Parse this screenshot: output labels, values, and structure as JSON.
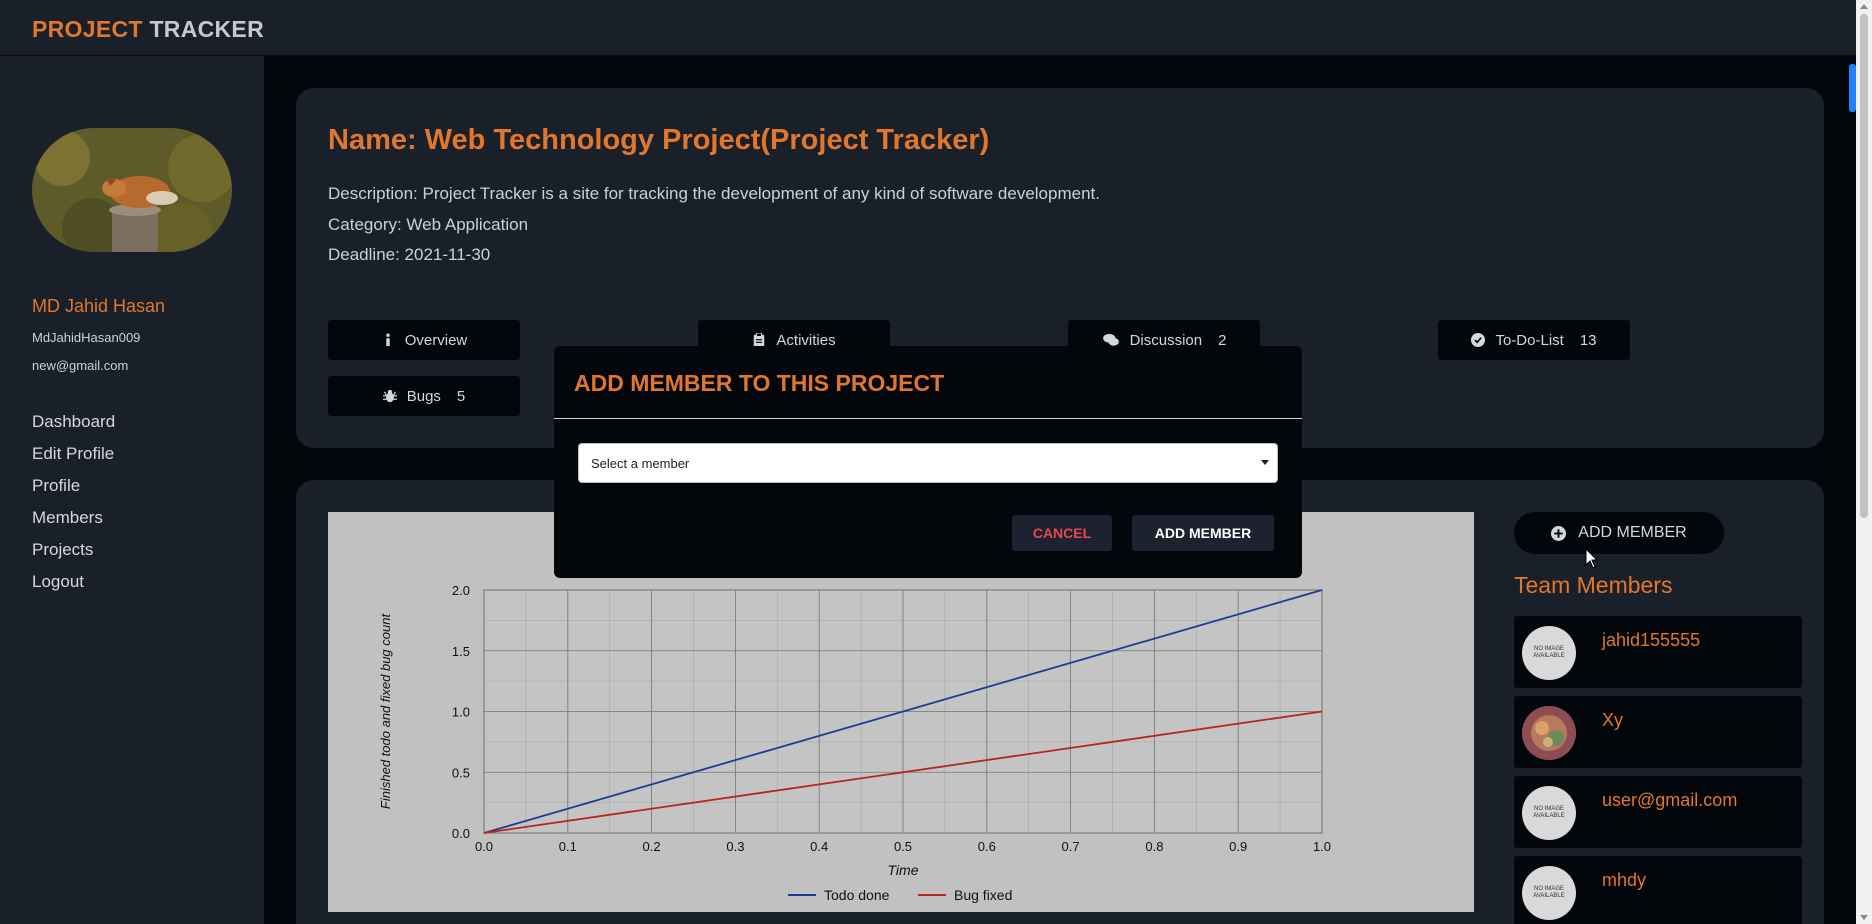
{
  "app": {
    "brand_part1": "PROJECT",
    "brand_part2": "TRACKER"
  },
  "user": {
    "name": "MD Jahid Hasan",
    "username": "MdJahidHasan009",
    "email": "new@gmail.com"
  },
  "sidebar": {
    "items": [
      {
        "label": "Dashboard"
      },
      {
        "label": "Edit Profile"
      },
      {
        "label": "Profile"
      },
      {
        "label": "Members"
      },
      {
        "label": "Projects"
      },
      {
        "label": "Logout"
      }
    ]
  },
  "project": {
    "name": "Name: Web Technology Project(Project Tracker)",
    "description": "Description: Project Tracker is a site for tracking the development of any kind of software development.",
    "category": "Category: Web Application",
    "deadline": "Deadline: 2021-11-30"
  },
  "tabs": {
    "overview": {
      "label": "Overview",
      "icon": "info-icon"
    },
    "activities": {
      "label": "Activities",
      "icon": "clipboard-icon"
    },
    "discussion": {
      "label": "Discussion",
      "count": "2",
      "icon": "comments-icon"
    },
    "todo": {
      "label": "To-Do-List",
      "count": "13",
      "icon": "check-circle-icon"
    },
    "bugs": {
      "label": "Bugs",
      "count": "5",
      "icon": "bug-icon"
    }
  },
  "team": {
    "add_button_label": "ADD MEMBER",
    "add_button_icon": "plus-circle-icon",
    "title": "Team Members",
    "no_image_text": "NO IMAGE AVAILABLE",
    "members": [
      {
        "name": "jahid155555",
        "image": "no-image"
      },
      {
        "name": "Xy",
        "image": "photo"
      },
      {
        "name": "user@gmail.com",
        "image": "no-image"
      },
      {
        "name": "mhdy",
        "image": "no-image"
      }
    ]
  },
  "modal": {
    "title": "ADD MEMBER TO THIS PROJECT",
    "select_placeholder": "Select a member",
    "cancel_label": "CANCEL",
    "add_label": "ADD MEMBER"
  },
  "colors": {
    "accent": "#e0772d",
    "series_todo": "#1a3d99",
    "series_bug": "#b8261b",
    "cancel": "#e5484d"
  },
  "chart_data": {
    "type": "line",
    "xlabel": "Time",
    "ylabel": "Finished todo and fixed bug count",
    "xlim": [
      0,
      1
    ],
    "ylim": [
      0,
      2
    ],
    "xticks": [
      "0.0",
      "0.1",
      "0.2",
      "0.3",
      "0.4",
      "0.5",
      "0.6",
      "0.7",
      "0.8",
      "0.9",
      "1.0"
    ],
    "yticks": [
      "0.0",
      "0.5",
      "1.0",
      "1.5",
      "2.0"
    ],
    "grid": true,
    "legend": "bottom",
    "series": [
      {
        "name": "Todo done",
        "x": [
          0,
          1
        ],
        "y": [
          0,
          2
        ]
      },
      {
        "name": "Bug fixed",
        "x": [
          0,
          1
        ],
        "y": [
          0,
          1
        ]
      }
    ]
  }
}
